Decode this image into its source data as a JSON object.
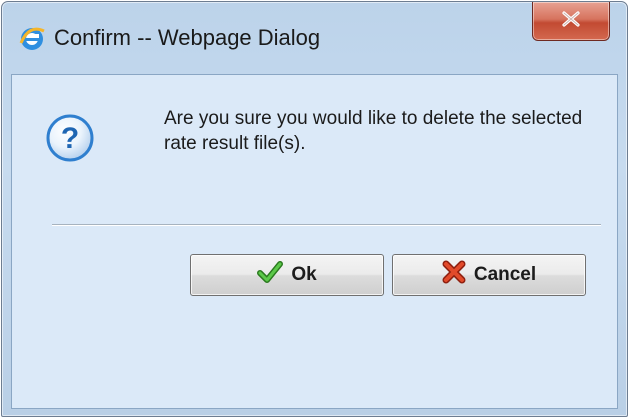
{
  "window": {
    "title": "Confirm -- Webpage Dialog",
    "close_label": "X"
  },
  "dialog": {
    "message": "Are you sure you would like to delete the selected rate result file(s).",
    "ok_label": "Ok",
    "cancel_label": "Cancel"
  },
  "icons": {
    "title": "internet-explorer-icon",
    "message": "question-icon",
    "ok": "checkmark-icon",
    "cancel": "red-x-icon"
  },
  "colors": {
    "close_button": "#c94a32",
    "question_icon": "#2f7fcf",
    "check": "#3da52e",
    "cancel_x": "#d33a1f"
  }
}
